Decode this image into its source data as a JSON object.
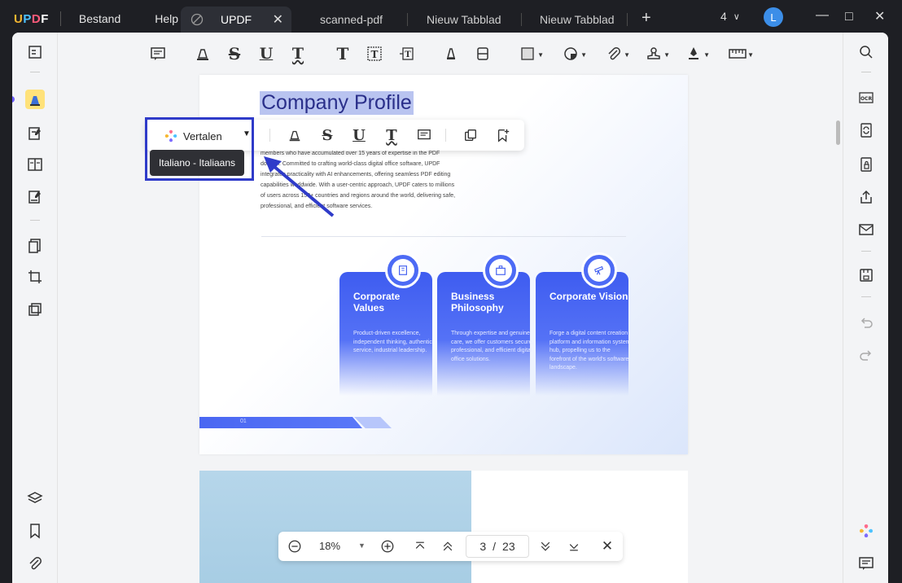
{
  "app": {
    "logo": "UPDF",
    "menus": [
      "Bestand",
      "Help"
    ]
  },
  "tabs": [
    {
      "label": "UPDF",
      "active": true
    },
    {
      "label": "scanned-pdf",
      "active": false
    },
    {
      "label": "Nieuw Tabblad",
      "active": false
    },
    {
      "label": "Nieuw Tabblad",
      "active": false
    }
  ],
  "titlebar": {
    "window_count": "4",
    "avatar_letter": "L"
  },
  "document": {
    "title": "Company Profile",
    "paragraph": "members who have accumulated over 15 years of expertise in the PDF domain. Committed to crafting world-class digital office software, UPDF integrates practicality with AI enhancements, offering seamless PDF editing capabilities worldwide. With a user-centric approach, UPDF caters to millions of users across 150+ countries and regions around the world, delivering safe, professional, and efficient software services.",
    "cards": [
      {
        "title": "Corporate Values",
        "body": "Product-driven excellence, independent thinking, authentic service, industrial leadership."
      },
      {
        "title": "Business Philosophy",
        "body": "Through expertise and genuine care, we offer customers secure, professional, and efficient digital office solutions."
      },
      {
        "title": "Corporate Vision",
        "body": "Forge a digital content creation platform and information system hub, propelling us to the forefront of the world's software landscape."
      }
    ],
    "page_label": "01"
  },
  "float_toolbar": {
    "translate_label": "Vertalen",
    "tooltip": "Italiano - Italiaans"
  },
  "bottom_nav": {
    "zoom": "18%",
    "current_page": "3",
    "separator": "/",
    "total_pages": "23"
  },
  "colors": {
    "accent": "#3e5cf0",
    "highlight_box": "#2f3bc9",
    "title_highlight": "#b9c4f0"
  }
}
